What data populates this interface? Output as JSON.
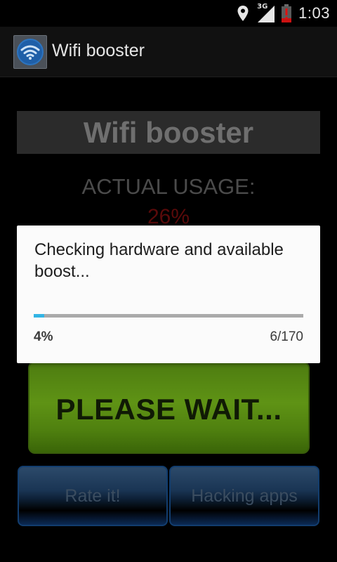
{
  "status_bar": {
    "time": "1:03",
    "network_type": "3G",
    "icons": [
      "location-icon",
      "signal-icon",
      "battery-icon"
    ]
  },
  "action_bar": {
    "app_title": "Wifi booster",
    "app_icon": "wifi-icon"
  },
  "main": {
    "title": "Wifi booster",
    "usage_label": "ACTUAL USAGE:",
    "usage_value": "26%",
    "wait_button_label": "PLEASE WAIT...",
    "rate_button_label": "Rate it!",
    "hacking_apps_button_label": "Hacking apps"
  },
  "dialog": {
    "message": "Checking hardware and available boost...",
    "progress_fraction": 0.04,
    "progress_percent_text": "4%",
    "progress_count_text": "6/170"
  },
  "colors": {
    "progress_fill": "#33b5e5",
    "usage_value": "#5a0a0a",
    "wait_button": "#5f9315"
  }
}
